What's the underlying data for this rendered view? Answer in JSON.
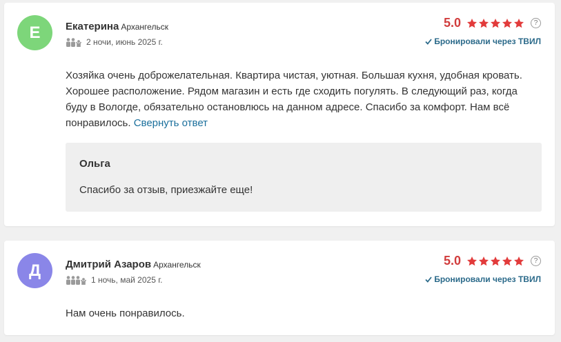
{
  "colors": {
    "star": "#e23b3b",
    "score": "#d13d3d",
    "link": "#1a6f9c",
    "booked": "#2b6a8a"
  },
  "reviews": [
    {
      "avatar_letter": "Е",
      "avatar_color": "#7dd67a",
      "name": "Екатерина",
      "city": "Архангельск",
      "guests_icon": "two-adults-one-child-icon",
      "stay": "2 ночи, июнь 2025 г.",
      "score": "5.0",
      "stars": 5,
      "help": "?",
      "booked": "Бронировали через ТВИЛ",
      "text": "Хозяйка очень доброжелательная. Квартира чистая, уютная. Большая кухня, удобная кровать. Хорошее расположение. Рядом магазин и есть где сходить погулять. В следующий раз, когда буду в Вологде, обязательно остановлюсь на данном адресе. Спасибо за комфорт. Нам всё понравилось.",
      "collapse_link": "Свернуть ответ",
      "reply": {
        "name": "Ольга",
        "text": "Спасибо за отзыв, приезжайте еще!"
      }
    },
    {
      "avatar_letter": "Д",
      "avatar_color": "#8a86e8",
      "name": "Дмитрий Азаров",
      "city": "Архангельск",
      "guests_icon": "three-adults-one-child-icon",
      "stay": "1 ночь, май 2025 г.",
      "score": "5.0",
      "stars": 5,
      "help": "?",
      "booked": "Бронировали через ТВИЛ",
      "text": "Нам очень понравилось."
    }
  ]
}
